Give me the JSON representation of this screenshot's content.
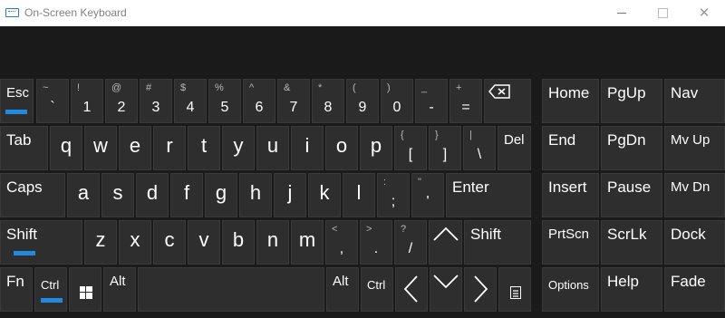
{
  "window": {
    "title": "On-Screen Keyboard",
    "minimize": "",
    "maximize": "",
    "close": "✕"
  },
  "accent_color": "#1f8ae0",
  "row1": {
    "esc": "Esc",
    "backtick": {
      "shift": "~",
      "main": "`"
    },
    "n1": {
      "shift": "!",
      "main": "1"
    },
    "n2": {
      "shift": "@",
      "main": "2"
    },
    "n3": {
      "shift": "#",
      "main": "3"
    },
    "n4": {
      "shift": "$",
      "main": "4"
    },
    "n5": {
      "shift": "%",
      "main": "5"
    },
    "n6": {
      "shift": "^",
      "main": "6"
    },
    "n7": {
      "shift": "&",
      "main": "7"
    },
    "n8": {
      "shift": "*",
      "main": "8"
    },
    "n9": {
      "shift": "(",
      "main": "9"
    },
    "n0": {
      "shift": ")",
      "main": "0"
    },
    "minus": {
      "shift": "_",
      "main": "-"
    },
    "equals": {
      "shift": "+",
      "main": "="
    },
    "backspace_icon": "backspace-icon"
  },
  "row2": {
    "tab": "Tab",
    "letters": [
      "q",
      "w",
      "e",
      "r",
      "t",
      "y",
      "u",
      "i",
      "o",
      "p"
    ],
    "lbracket": {
      "shift": "{",
      "main": "["
    },
    "rbracket": {
      "shift": "}",
      "main": "]"
    },
    "backslash": {
      "shift": "|",
      "main": "\\"
    },
    "del": "Del"
  },
  "row3": {
    "caps": "Caps",
    "letters": [
      "a",
      "s",
      "d",
      "f",
      "g",
      "h",
      "j",
      "k",
      "l"
    ],
    "semicolon": {
      "shift": ":",
      "main": ";"
    },
    "quote": {
      "shift": "\"",
      "main": "'"
    },
    "enter": "Enter"
  },
  "row4": {
    "shift": "Shift",
    "letters": [
      "z",
      "x",
      "c",
      "v",
      "b",
      "n",
      "m"
    ],
    "comma": {
      "shift": "<",
      "main": ","
    },
    "period": {
      "shift": ">",
      "main": "."
    },
    "slash": {
      "shift": "?",
      "main": "/"
    },
    "rshift": "Shift"
  },
  "row5": {
    "fn": "Fn",
    "ctrl": "Ctrl",
    "alt": "Alt",
    "ralt": "Alt",
    "rctrl": "Ctrl"
  },
  "nav": {
    "home": "Home",
    "pgup": "PgUp",
    "navkey": "Nav",
    "end": "End",
    "pgdn": "PgDn",
    "mvup": "Mv Up",
    "insert": "Insert",
    "pause": "Pause",
    "mvdn": "Mv Dn",
    "prtscn": "PrtScn",
    "scrlk": "ScrLk",
    "dock": "Dock",
    "options": "Options",
    "help": "Help",
    "fade": "Fade"
  }
}
